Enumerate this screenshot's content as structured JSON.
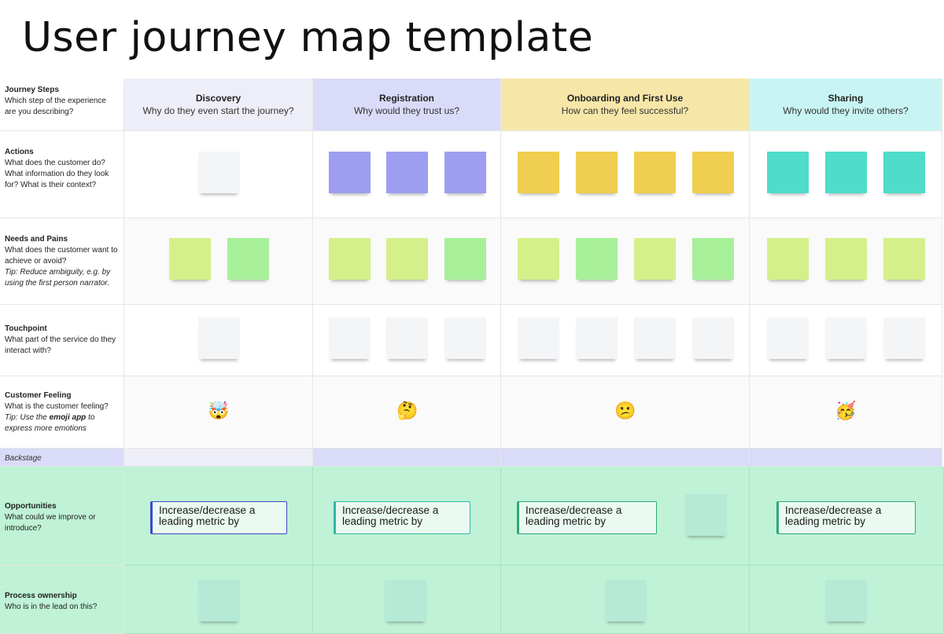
{
  "title": "User journey map template",
  "colors": {
    "discovery_header": "#eeeef8",
    "registration_header": "#d9dbf8",
    "onboarding_header": "#f6e7a9",
    "sharing_header": "#c8f5f3",
    "backstage_band": "#d9dbf8",
    "bottom_band": "#bff2d6",
    "note_purple": "#9d9ef0",
    "note_yellow": "#f0ce4f",
    "note_teal": "#4fdccb",
    "note_lime": "#d5f08a",
    "note_green": "#a8ef9a",
    "note_white": "#f4f5f7",
    "note_mint": "#b4ead6"
  },
  "rows": {
    "journey_steps": {
      "title": "Journey Steps",
      "desc": "Which step of the experience are you describing?"
    },
    "actions": {
      "title": "Actions",
      "desc": "What does the customer do? What information do they look for? What is their context?"
    },
    "needs": {
      "title": "Needs and Pains",
      "desc": "What does the customer want to achieve or avoid?",
      "tip": "Tip: Reduce ambiguity, e.g. by using the first person narrator."
    },
    "touchpoint": {
      "title": "Touchpoint",
      "desc": "What part of the service do they interact with?"
    },
    "feeling": {
      "title": "Customer Feeling",
      "desc": "What is the customer feeling?",
      "tip_pre": "Tip: Use the ",
      "tip_bold": "emoji app",
      "tip_post": " to express more emotions"
    },
    "backstage": "Backstage",
    "opportunities": {
      "title": "Opportunities",
      "desc": "What could we improve or introduce?"
    },
    "ownership": {
      "title": "Process ownership",
      "desc": "Who is in the lead on this?"
    }
  },
  "stages": [
    {
      "name": "Discovery",
      "question": "Why do they even start the journey?",
      "emoji": "🤯",
      "emoji_name": "exploding-head-emoji"
    },
    {
      "name": "Registration",
      "question": "Why would they trust us?",
      "emoji": "🤔",
      "emoji_name": "thinking-face-emoji"
    },
    {
      "name": "Onboarding and First Use",
      "question": "How can they feel successful?",
      "emoji": "😕",
      "emoji_name": "confused-face-emoji"
    },
    {
      "name": "Sharing",
      "question": "Why would they invite others?",
      "emoji": "🥳",
      "emoji_name": "partying-face-emoji"
    }
  ],
  "metric_text": "Increase/decrease a leading metric by",
  "metric_border_colors": [
    "#3b49c4",
    "#2eb8a8",
    "#2ea878",
    "#2ea878"
  ]
}
